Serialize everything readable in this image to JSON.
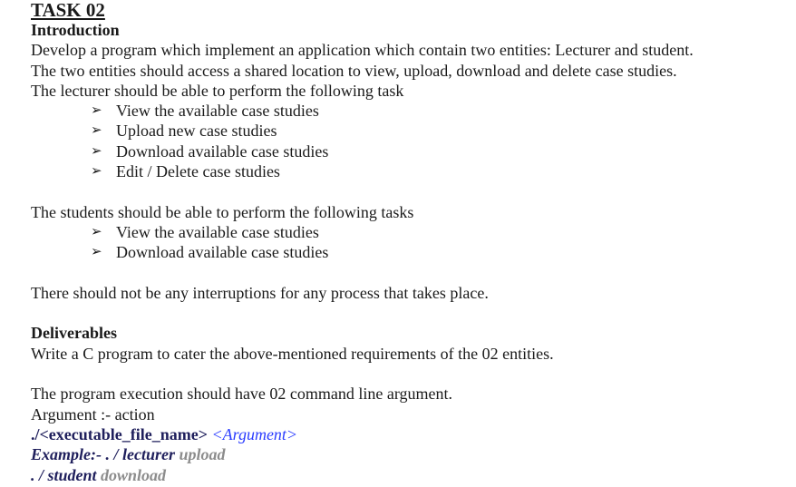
{
  "task_title": "TASK 02",
  "intro_heading": "Introduction",
  "intro_lines": [
    "Develop a program which implement an application which contain two entities: Lecturer and student.",
    "The two entities should access a shared location to view, upload, download and delete case studies.",
    "The lecturer should be able to perform the following task"
  ],
  "bullet_symbol": "➢",
  "lecturer_tasks": [
    "View the available case studies",
    "Upload new case studies",
    "Download available case studies",
    "Edit / Delete case studies"
  ],
  "students_intro": "The students should be able to perform the following tasks",
  "student_tasks": [
    "View the available case studies",
    "Download available case studies"
  ],
  "interruption_note": "There should not be any interruptions for any process that takes place.",
  "deliverables_heading": "Deliverables",
  "deliverables_text": "Write a C program to cater the above-mentioned requirements of the 02 entities.",
  "execution_line": "The program execution should have 02 command line argument.",
  "argument_line": "Argument :- action",
  "usage": {
    "prefix": "./<executable_file_name>",
    "argument": "<Argument>"
  },
  "example1": {
    "label": "Example:- . / lecturer",
    "action": "upload"
  },
  "example2": {
    "label": ". / student",
    "action": "download"
  },
  "colors": {
    "text": "#1a1a1a",
    "command": "#1f1f5c",
    "argument_blue": "#2a3cff",
    "action_grey": "#8c8c8c"
  }
}
